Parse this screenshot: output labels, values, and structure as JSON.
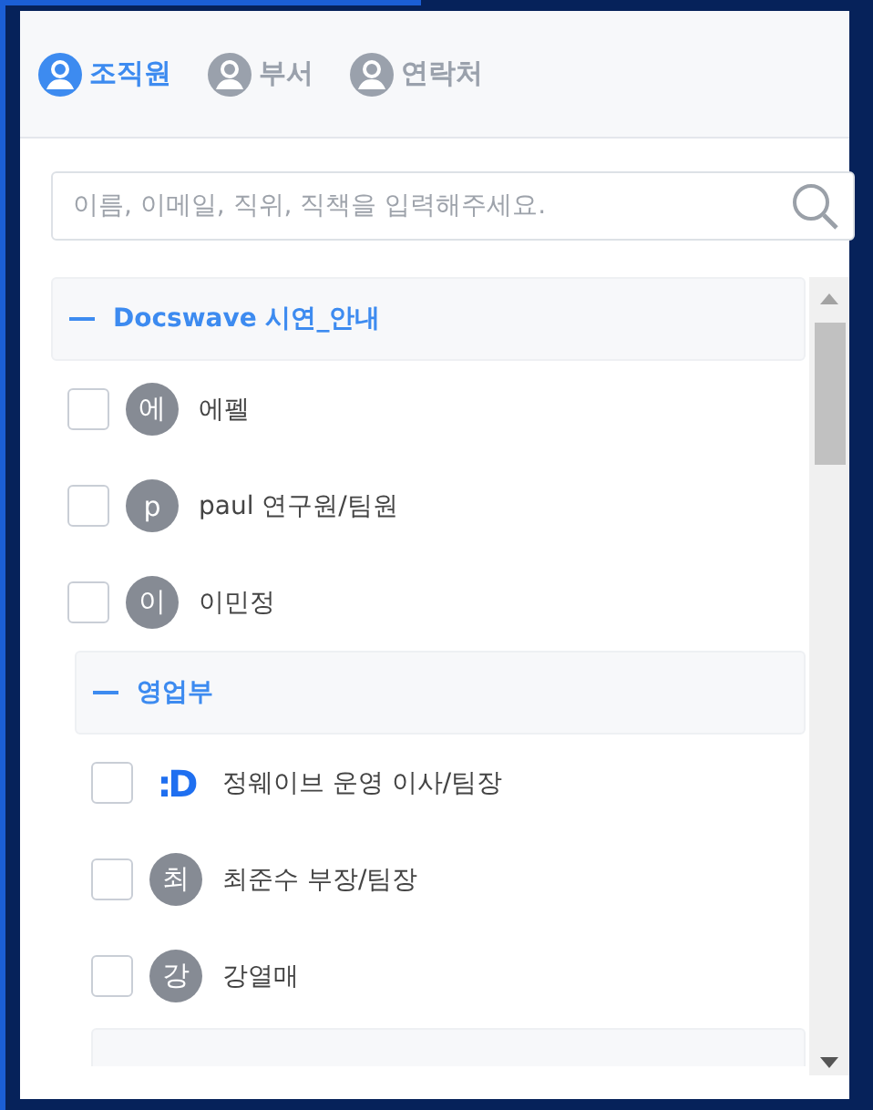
{
  "tabs": [
    {
      "label": "조직원",
      "selected": true
    },
    {
      "label": "부서",
      "selected": false
    },
    {
      "label": "연락처",
      "selected": false
    }
  ],
  "search": {
    "placeholder": "이름, 이메일, 직위, 직책을 입력해주세요."
  },
  "tree": [
    {
      "kind": "group",
      "label": "Docswave 시연_안내",
      "expanded": true,
      "children": [
        {
          "kind": "member",
          "avatar": {
            "kind": "initial",
            "text": "에"
          },
          "name": "에펠",
          "checked": false
        },
        {
          "kind": "member",
          "avatar": {
            "kind": "initial",
            "text": "p"
          },
          "name": "paul 연구원/팀원",
          "checked": false
        },
        {
          "kind": "member",
          "avatar": {
            "kind": "initial",
            "text": "이"
          },
          "name": "이민정",
          "checked": false
        },
        {
          "kind": "group",
          "label": "영업부",
          "expanded": true,
          "children": [
            {
              "kind": "member",
              "avatar": {
                "kind": "logo",
                "text": ":D"
              },
              "name": "정웨이브 운영 이사/팀장",
              "checked": false
            },
            {
              "kind": "member",
              "avatar": {
                "kind": "initial",
                "text": "최"
              },
              "name": "최준수 부장/팀장",
              "checked": false
            },
            {
              "kind": "member",
              "avatar": {
                "kind": "initial",
                "text": "강"
              },
              "name": "강열매",
              "checked": false
            }
          ]
        }
      ]
    }
  ]
}
